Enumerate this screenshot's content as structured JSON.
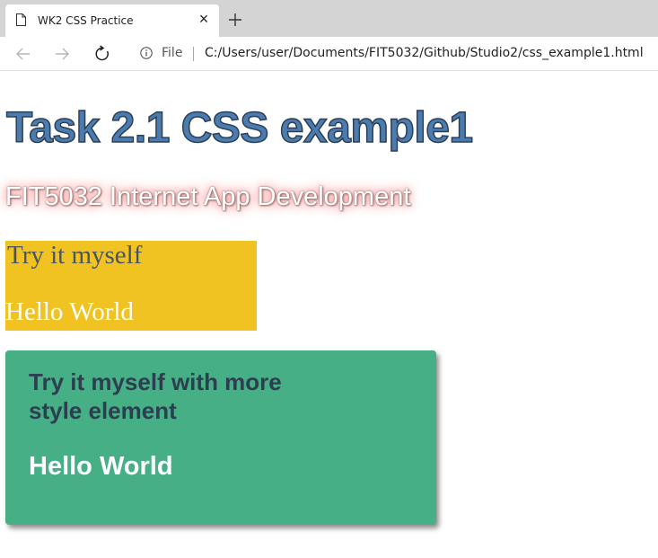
{
  "browser": {
    "tab_title": "WK2 CSS Practice",
    "tab_close": "×",
    "address": {
      "scheme_label": "File",
      "url": "C:/Users/user/Documents/FIT5032/Github/Studio2/css_example1.html"
    },
    "icons": [
      "page-icon",
      "close-icon",
      "plus-icon",
      "back-arrow-icon",
      "forward-arrow-icon",
      "reload-icon",
      "info-icon"
    ]
  },
  "page": {
    "heading": "Task 2.1 CSS example1",
    "subheading": "FIT5032 Internet App Development",
    "yellow_box": {
      "line1": "Try it myself",
      "line2": "Hello World"
    },
    "green_box": {
      "line1": "Try it myself with more style element",
      "line2": "Hello World"
    }
  },
  "colors": {
    "heading": "#4a7cb0",
    "yellow_box": "#f0c322",
    "green_box": "#46af85",
    "green_box_text": "#2c3e50"
  }
}
